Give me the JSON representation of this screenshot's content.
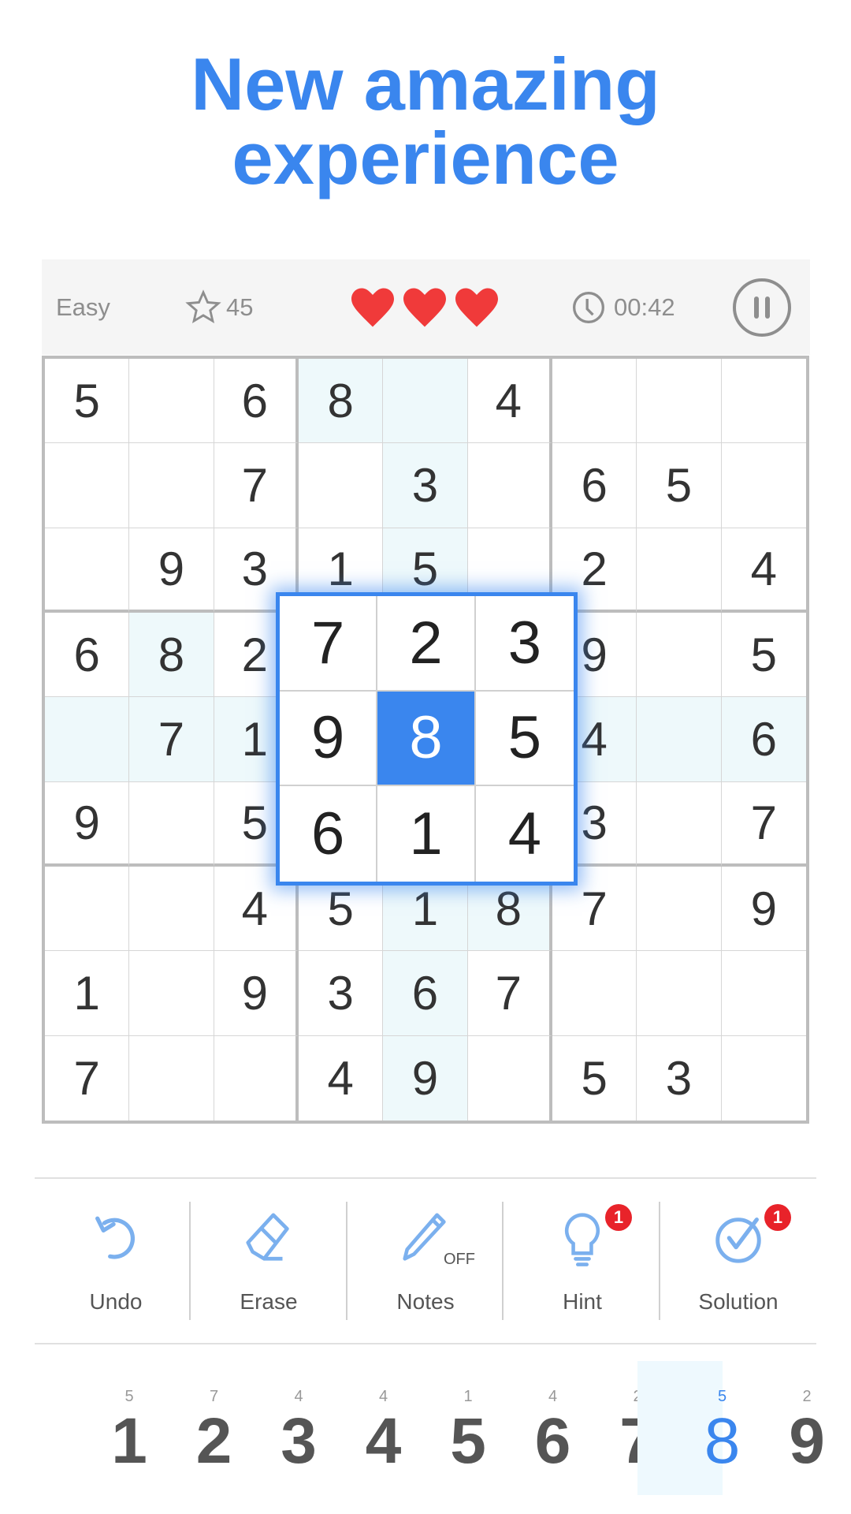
{
  "title": {
    "line1": "New amazing",
    "line2": "experience"
  },
  "header": {
    "difficulty": "Easy",
    "score": "45",
    "lives": 3,
    "timer": "00:42",
    "icons": [
      "star-icon",
      "heart-icon",
      "clock-icon",
      "pause-icon"
    ]
  },
  "board": {
    "rows": [
      [
        "5",
        "",
        "6",
        "8",
        "",
        "4",
        "",
        "",
        ""
      ],
      [
        "",
        "",
        "7",
        "",
        "3",
        "",
        "6",
        "5",
        ""
      ],
      [
        "",
        "9",
        "3",
        "1",
        "5",
        "",
        "2",
        "",
        "4"
      ],
      [
        "6",
        "8",
        "2",
        "",
        "",
        "",
        "9",
        "",
        "5"
      ],
      [
        "",
        "7",
        "1",
        "",
        "",
        "",
        "4",
        "",
        "6"
      ],
      [
        "9",
        "",
        "5",
        "",
        "",
        "",
        "3",
        "",
        "7"
      ],
      [
        "",
        "",
        "4",
        "5",
        "1",
        "8",
        "7",
        "",
        "9"
      ],
      [
        "1",
        "",
        "9",
        "3",
        "6",
        "7",
        "",
        "",
        ""
      ],
      [
        "7",
        "",
        "",
        "4",
        "9",
        "",
        "5",
        "3",
        ""
      ]
    ],
    "selected": {
      "row": 5,
      "col": 5,
      "value": "8"
    }
  },
  "zoom_box": {
    "cells": [
      "7",
      "2",
      "3",
      "9",
      "8",
      "5",
      "6",
      "1",
      "4"
    ],
    "selected_index": 4
  },
  "toolbar": {
    "undo": "Undo",
    "erase": "Erase",
    "notes": "Notes",
    "notes_state": "OFF",
    "hint": "Hint",
    "hint_badge": "1",
    "solution": "Solution",
    "solution_badge": "1"
  },
  "numpad": [
    {
      "digit": "1",
      "count": "5"
    },
    {
      "digit": "2",
      "count": "7"
    },
    {
      "digit": "3",
      "count": "4"
    },
    {
      "digit": "4",
      "count": "4"
    },
    {
      "digit": "5",
      "count": "1"
    },
    {
      "digit": "6",
      "count": "4"
    },
    {
      "digit": "7",
      "count": "2"
    },
    {
      "digit": "8",
      "count": "5",
      "active": true
    },
    {
      "digit": "9",
      "count": "2"
    }
  ],
  "colors": {
    "accent": "#3a86ee",
    "heart": "#f03a3a",
    "highlight": "#eef9fb",
    "badge": "#e8232a"
  }
}
